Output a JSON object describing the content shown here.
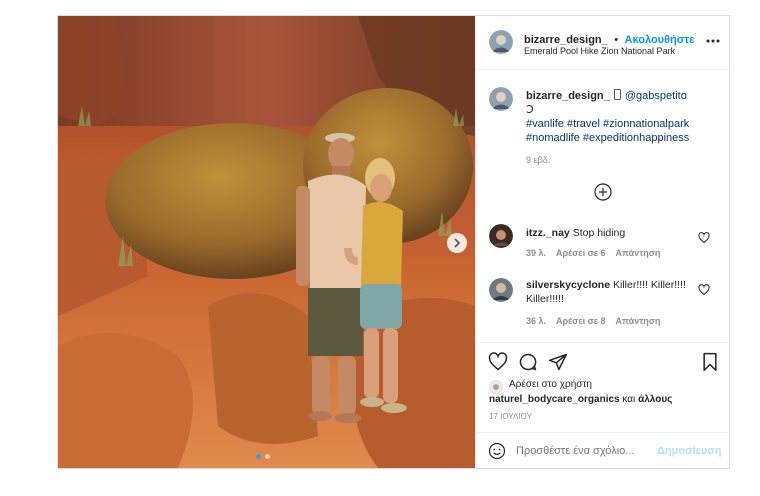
{
  "header": {
    "username": "bizarre_design_",
    "separator": "•",
    "follow_label": "Ακολουθήστε",
    "location": "Emerald Pool Hike Zion National Park",
    "more_icon": "more-icon"
  },
  "caption": {
    "username": "bizarre_design_",
    "mention": "@gabspetito",
    "second_line": "Ↄ",
    "hashtags_line1": "#vanlife #travel #zionnationalpark",
    "hashtags_line2": "#nomadlife #expeditionhappiness",
    "time": "9 εβδ."
  },
  "comments": [
    {
      "username": "itzz._nay",
      "text": "Stop hiding",
      "time": "39 λ.",
      "likes": "Αρέσει σε 6",
      "reply": "Απάντηση"
    },
    {
      "username": "silverskycyclone",
      "text": "Killer!!!! Killer!!!! Killer!!!!!",
      "time": "36 λ.",
      "likes": "Αρέσει σε 8",
      "reply": "Απάντηση"
    }
  ],
  "likes": {
    "prefix": "Αρέσει στο χρήστη",
    "user": "naturel_bodycare_organics",
    "connector": "και",
    "others": "άλλους"
  },
  "date": "17 ΙΟΥΛΙΟΥ",
  "composer": {
    "placeholder": "Προσθέστε ένα σχόλιο...",
    "post_label": "Δημοσίευση"
  },
  "carousel": {
    "current": 1,
    "total": 2
  },
  "colors": {
    "link": "#0095f6",
    "hashtag": "#00376b",
    "text": "#262626",
    "muted": "#8e8e8e",
    "post_disabled": "#b2dffc"
  }
}
